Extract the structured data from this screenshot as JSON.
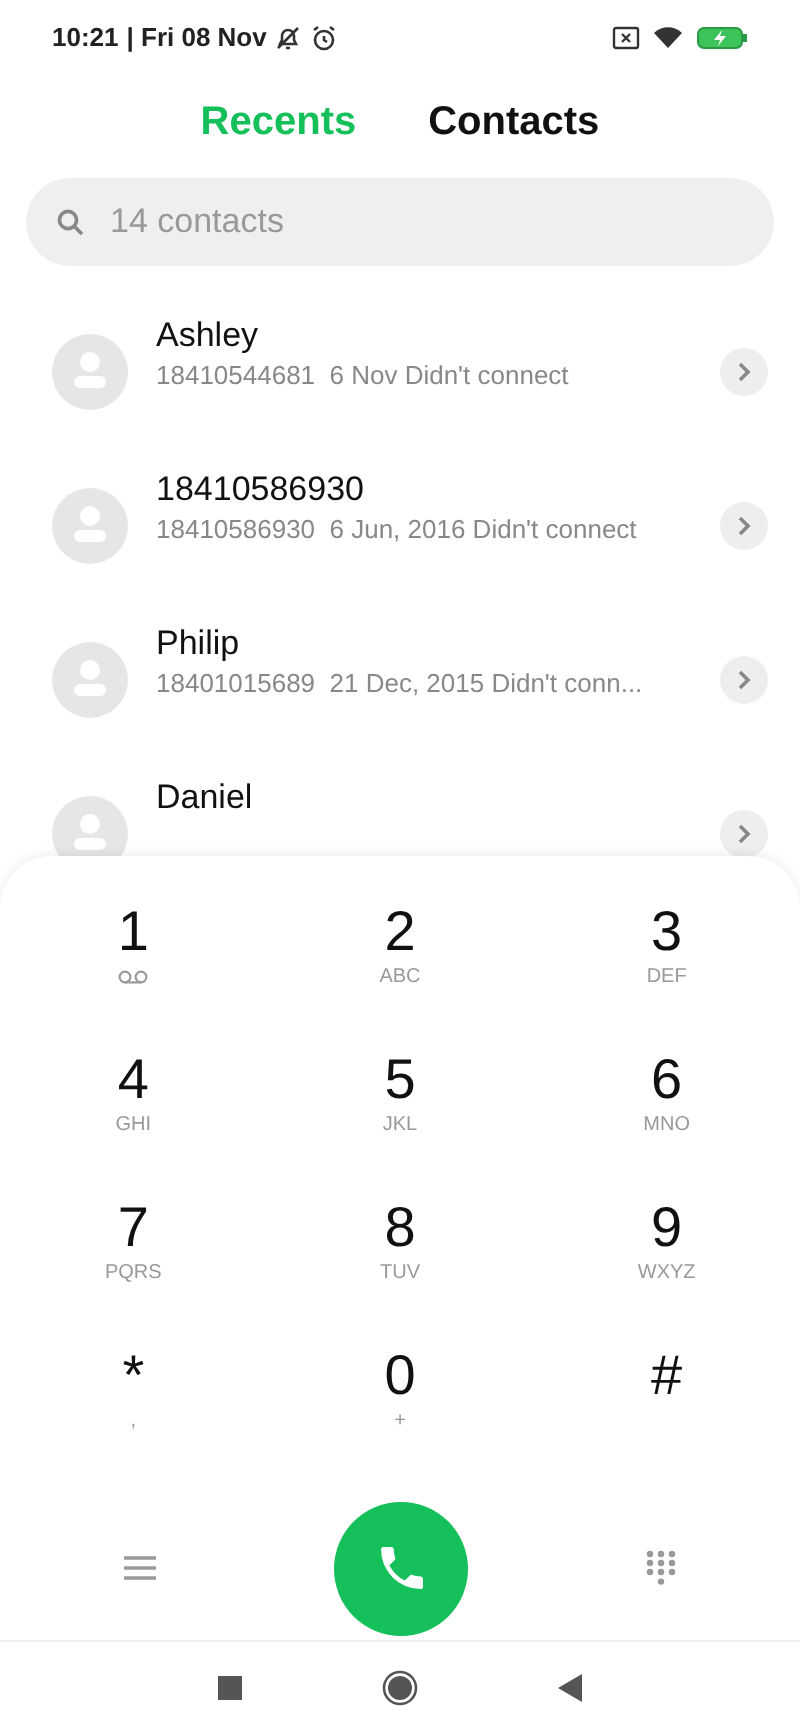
{
  "status_bar": {
    "time": "10:21",
    "date": "| Fri 08 Nov"
  },
  "tabs": [
    {
      "label": "Recents",
      "selected": true
    },
    {
      "label": "Contacts",
      "selected": false
    }
  ],
  "search": {
    "placeholder": "14 contacts"
  },
  "calls": [
    {
      "name": "Ashley",
      "detail": "18410544681  6 Nov Didn't connect"
    },
    {
      "name": "18410586930",
      "detail": "18410586930  6 Jun, 2016 Didn't connect"
    },
    {
      "name": "Philip",
      "detail": "18401015689  21 Dec, 2015 Didn't conn..."
    },
    {
      "name": "Daniel"
    }
  ],
  "keypad": [
    {
      "digit": "1",
      "kind": "voicemail"
    },
    {
      "digit": "2",
      "letters": "ABC",
      "kind": "letters"
    },
    {
      "digit": "3",
      "letters": "DEF",
      "kind": "letters"
    },
    {
      "digit": "4",
      "letters": "GHI",
      "kind": "letters"
    },
    {
      "digit": "5",
      "letters": "JKL",
      "kind": "letters"
    },
    {
      "digit": "6",
      "letters": "MNO",
      "kind": "letters"
    },
    {
      "digit": "7",
      "letters": "PQRS",
      "kind": "letters"
    },
    {
      "digit": "8",
      "letters": "TUV",
      "kind": "letters"
    },
    {
      "digit": "9",
      "letters": "WXYZ",
      "kind": "letters"
    },
    {
      "digit": "*",
      "letters": ",",
      "kind": "letters"
    },
    {
      "digit": "0",
      "letters": "+",
      "kind": "letters"
    },
    {
      "digit": "#",
      "kind": "plain"
    }
  ]
}
